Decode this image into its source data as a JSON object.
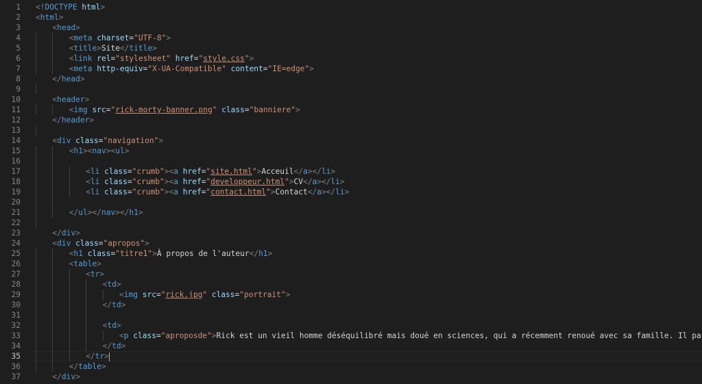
{
  "editor": {
    "active_line": 35,
    "lines": [
      {
        "n": "1",
        "indent": 0,
        "tokens": [
          [
            "punct",
            "<!"
          ],
          [
            "doctype",
            "DOCTYPE "
          ],
          [
            "attr",
            "html"
          ],
          [
            "punct",
            ">"
          ]
        ]
      },
      {
        "n": "2",
        "indent": 0,
        "tokens": [
          [
            "punct",
            "<"
          ],
          [
            "tag",
            "html"
          ],
          [
            "punct",
            ">"
          ]
        ]
      },
      {
        "n": "3",
        "indent": 1,
        "tokens": [
          [
            "punct",
            "<"
          ],
          [
            "tag",
            "head"
          ],
          [
            "punct",
            ">"
          ]
        ]
      },
      {
        "n": "4",
        "indent": 2,
        "tokens": [
          [
            "punct",
            "<"
          ],
          [
            "tag",
            "meta"
          ],
          [
            "text",
            " "
          ],
          [
            "attr",
            "charset"
          ],
          [
            "eq",
            "="
          ],
          [
            "str",
            "\"UTF-8\""
          ],
          [
            "punct",
            ">"
          ]
        ]
      },
      {
        "n": "5",
        "indent": 2,
        "tokens": [
          [
            "punct",
            "<"
          ],
          [
            "tag",
            "title"
          ],
          [
            "punct",
            ">"
          ],
          [
            "text",
            "Site"
          ],
          [
            "punct",
            "</"
          ],
          [
            "tag",
            "title"
          ],
          [
            "punct",
            ">"
          ]
        ]
      },
      {
        "n": "6",
        "indent": 2,
        "tokens": [
          [
            "punct",
            "<"
          ],
          [
            "tag",
            "link"
          ],
          [
            "text",
            " "
          ],
          [
            "attr",
            "rel"
          ],
          [
            "eq",
            "="
          ],
          [
            "str",
            "\"stylesheet\""
          ],
          [
            "text",
            " "
          ],
          [
            "attr",
            "href"
          ],
          [
            "eq",
            "="
          ],
          [
            "str",
            "\""
          ],
          [
            "link",
            "style.css"
          ],
          [
            "str",
            "\""
          ],
          [
            "punct",
            ">"
          ]
        ]
      },
      {
        "n": "7",
        "indent": 2,
        "tokens": [
          [
            "punct",
            "<"
          ],
          [
            "tag",
            "meta"
          ],
          [
            "text",
            " "
          ],
          [
            "attr",
            "http-equiv"
          ],
          [
            "eq",
            "="
          ],
          [
            "str",
            "\"X-UA-Compatible\""
          ],
          [
            "text",
            " "
          ],
          [
            "attr",
            "content"
          ],
          [
            "eq",
            "="
          ],
          [
            "str",
            "\"IE=edge\""
          ],
          [
            "punct",
            ">"
          ]
        ]
      },
      {
        "n": "8",
        "indent": 1,
        "tokens": [
          [
            "punct",
            "</"
          ],
          [
            "tag",
            "head"
          ],
          [
            "punct",
            ">"
          ]
        ]
      },
      {
        "n": "9",
        "indent": 0,
        "tokens": []
      },
      {
        "n": "10",
        "indent": 1,
        "tokens": [
          [
            "punct",
            "<"
          ],
          [
            "tag",
            "header"
          ],
          [
            "punct",
            ">"
          ]
        ]
      },
      {
        "n": "11",
        "indent": 2,
        "tokens": [
          [
            "punct",
            "<"
          ],
          [
            "tag",
            "img"
          ],
          [
            "text",
            " "
          ],
          [
            "attr",
            "src"
          ],
          [
            "eq",
            "="
          ],
          [
            "str",
            "\""
          ],
          [
            "link",
            "rick-morty-banner.png"
          ],
          [
            "str",
            "\""
          ],
          [
            "text",
            " "
          ],
          [
            "attr",
            "class"
          ],
          [
            "eq",
            "="
          ],
          [
            "str",
            "\"banniere\""
          ],
          [
            "punct",
            ">"
          ]
        ]
      },
      {
        "n": "12",
        "indent": 1,
        "tokens": [
          [
            "punct",
            "</"
          ],
          [
            "tag",
            "header"
          ],
          [
            "punct",
            ">"
          ]
        ]
      },
      {
        "n": "13",
        "indent": 0,
        "tokens": []
      },
      {
        "n": "14",
        "indent": 1,
        "tokens": [
          [
            "punct",
            "<"
          ],
          [
            "tag",
            "div"
          ],
          [
            "text",
            " "
          ],
          [
            "attr",
            "class"
          ],
          [
            "eq",
            "="
          ],
          [
            "str",
            "\"navigation\""
          ],
          [
            "punct",
            ">"
          ]
        ]
      },
      {
        "n": "15",
        "indent": 2,
        "tokens": [
          [
            "punct",
            "<"
          ],
          [
            "tag",
            "h1"
          ],
          [
            "punct",
            "><"
          ],
          [
            "tag",
            "nav"
          ],
          [
            "punct",
            "><"
          ],
          [
            "tag",
            "ul"
          ],
          [
            "punct",
            ">"
          ]
        ]
      },
      {
        "n": "16",
        "indent": 0,
        "tokens": []
      },
      {
        "n": "17",
        "indent": 3,
        "tokens": [
          [
            "punct",
            "<"
          ],
          [
            "tag",
            "li"
          ],
          [
            "text",
            " "
          ],
          [
            "attr",
            "class"
          ],
          [
            "eq",
            "="
          ],
          [
            "str",
            "\"crumb\""
          ],
          [
            "punct",
            "><"
          ],
          [
            "tag",
            "a"
          ],
          [
            "text",
            " "
          ],
          [
            "attr",
            "href"
          ],
          [
            "eq",
            "="
          ],
          [
            "str",
            "\""
          ],
          [
            "link",
            "site.html"
          ],
          [
            "str",
            "\""
          ],
          [
            "punct",
            ">"
          ],
          [
            "text",
            "Acceuil"
          ],
          [
            "punct",
            "</"
          ],
          [
            "tag",
            "a"
          ],
          [
            "punct",
            "></"
          ],
          [
            "tag",
            "li"
          ],
          [
            "punct",
            ">"
          ]
        ]
      },
      {
        "n": "18",
        "indent": 3,
        "tokens": [
          [
            "punct",
            "<"
          ],
          [
            "tag",
            "li"
          ],
          [
            "text",
            " "
          ],
          [
            "attr",
            "class"
          ],
          [
            "eq",
            "="
          ],
          [
            "str",
            "\"crumb\""
          ],
          [
            "punct",
            "><"
          ],
          [
            "tag",
            "a"
          ],
          [
            "text",
            " "
          ],
          [
            "attr",
            "href"
          ],
          [
            "eq",
            "="
          ],
          [
            "str",
            "\""
          ],
          [
            "link",
            "developpeur.html"
          ],
          [
            "str",
            "\""
          ],
          [
            "punct",
            ">"
          ],
          [
            "text",
            "CV"
          ],
          [
            "punct",
            "</"
          ],
          [
            "tag",
            "a"
          ],
          [
            "punct",
            "></"
          ],
          [
            "tag",
            "li"
          ],
          [
            "punct",
            ">"
          ]
        ]
      },
      {
        "n": "19",
        "indent": 3,
        "tokens": [
          [
            "punct",
            "<"
          ],
          [
            "tag",
            "li"
          ],
          [
            "text",
            " "
          ],
          [
            "attr",
            "class"
          ],
          [
            "eq",
            "="
          ],
          [
            "str",
            "\"crumb\""
          ],
          [
            "punct",
            "><"
          ],
          [
            "tag",
            "a"
          ],
          [
            "text",
            " "
          ],
          [
            "attr",
            "href"
          ],
          [
            "eq",
            "="
          ],
          [
            "str",
            "\""
          ],
          [
            "link",
            "contact.html"
          ],
          [
            "str",
            "\""
          ],
          [
            "punct",
            ">"
          ],
          [
            "text",
            "Contact"
          ],
          [
            "punct",
            "</"
          ],
          [
            "tag",
            "a"
          ],
          [
            "punct",
            "></"
          ],
          [
            "tag",
            "li"
          ],
          [
            "punct",
            ">"
          ]
        ]
      },
      {
        "n": "20",
        "indent": 0,
        "tokens": []
      },
      {
        "n": "21",
        "indent": 2,
        "tokens": [
          [
            "punct",
            "</"
          ],
          [
            "tag",
            "ul"
          ],
          [
            "punct",
            "></"
          ],
          [
            "tag",
            "nav"
          ],
          [
            "punct",
            "></"
          ],
          [
            "tag",
            "h1"
          ],
          [
            "punct",
            ">"
          ]
        ]
      },
      {
        "n": "22",
        "indent": 0,
        "tokens": []
      },
      {
        "n": "23",
        "indent": 1,
        "tokens": [
          [
            "punct",
            "</"
          ],
          [
            "tag",
            "div"
          ],
          [
            "punct",
            ">"
          ]
        ]
      },
      {
        "n": "24",
        "indent": 1,
        "tokens": [
          [
            "punct",
            "<"
          ],
          [
            "tag",
            "div"
          ],
          [
            "text",
            " "
          ],
          [
            "attr",
            "class"
          ],
          [
            "eq",
            "="
          ],
          [
            "str",
            "\"apropos\""
          ],
          [
            "punct",
            ">"
          ]
        ]
      },
      {
        "n": "25",
        "indent": 2,
        "tokens": [
          [
            "punct",
            "<"
          ],
          [
            "tag",
            "h1"
          ],
          [
            "text",
            " "
          ],
          [
            "attr",
            "class"
          ],
          [
            "eq",
            "="
          ],
          [
            "str",
            "\"titre1\""
          ],
          [
            "punct",
            ">"
          ],
          [
            "text",
            "À propos de l'auteur"
          ],
          [
            "punct",
            "</"
          ],
          [
            "tag",
            "h1"
          ],
          [
            "punct",
            ">"
          ]
        ]
      },
      {
        "n": "26",
        "indent": 2,
        "tokens": [
          [
            "punct",
            "<"
          ],
          [
            "tag",
            "table"
          ],
          [
            "punct",
            ">"
          ]
        ]
      },
      {
        "n": "27",
        "indent": 3,
        "tokens": [
          [
            "punct",
            "<"
          ],
          [
            "tag",
            "tr"
          ],
          [
            "punct",
            ">"
          ]
        ]
      },
      {
        "n": "28",
        "indent": 4,
        "tokens": [
          [
            "punct",
            "<"
          ],
          [
            "tag",
            "td"
          ],
          [
            "punct",
            ">"
          ]
        ]
      },
      {
        "n": "29",
        "indent": 5,
        "tokens": [
          [
            "punct",
            "<"
          ],
          [
            "tag",
            "img"
          ],
          [
            "text",
            " "
          ],
          [
            "attr",
            "src"
          ],
          [
            "eq",
            "="
          ],
          [
            "str",
            "\""
          ],
          [
            "link",
            "rick.jpg"
          ],
          [
            "str",
            "\""
          ],
          [
            "text",
            " "
          ],
          [
            "attr",
            "class"
          ],
          [
            "eq",
            "="
          ],
          [
            "str",
            "\"portrait\""
          ],
          [
            "punct",
            ">"
          ]
        ]
      },
      {
        "n": "30",
        "indent": 4,
        "tokens": [
          [
            "punct",
            "</"
          ],
          [
            "tag",
            "td"
          ],
          [
            "punct",
            ">"
          ]
        ]
      },
      {
        "n": "31",
        "indent": 0,
        "tokens": []
      },
      {
        "n": "32",
        "indent": 4,
        "tokens": [
          [
            "punct",
            "<"
          ],
          [
            "tag",
            "td"
          ],
          [
            "punct",
            ">"
          ]
        ]
      },
      {
        "n": "33",
        "indent": 5,
        "tokens": [
          [
            "punct",
            "<"
          ],
          [
            "tag",
            "p"
          ],
          [
            "text",
            " "
          ],
          [
            "attr",
            "class"
          ],
          [
            "eq",
            "="
          ],
          [
            "str",
            "\"aproposde\""
          ],
          [
            "punct",
            ">"
          ],
          [
            "text",
            "Rick est un vieil homme déséquilibré mais doué en sciences, qui a récemment renoué avec sa famille. Il passe le plus cla"
          ]
        ]
      },
      {
        "n": "34",
        "indent": 4,
        "tokens": [
          [
            "punct",
            "</"
          ],
          [
            "tag",
            "td"
          ],
          [
            "punct",
            ">"
          ]
        ]
      },
      {
        "n": "35",
        "indent": 3,
        "tokens": [
          [
            "punct",
            "</"
          ],
          [
            "tag",
            "tr"
          ],
          [
            "punct",
            ">"
          ]
        ],
        "cursor": true
      },
      {
        "n": "36",
        "indent": 2,
        "tokens": [
          [
            "punct",
            "</"
          ],
          [
            "tag",
            "table"
          ],
          [
            "punct",
            ">"
          ]
        ]
      },
      {
        "n": "37",
        "indent": 1,
        "tokens": [
          [
            "punct",
            "</"
          ],
          [
            "tag",
            "div"
          ],
          [
            "punct",
            ">"
          ]
        ]
      }
    ]
  }
}
